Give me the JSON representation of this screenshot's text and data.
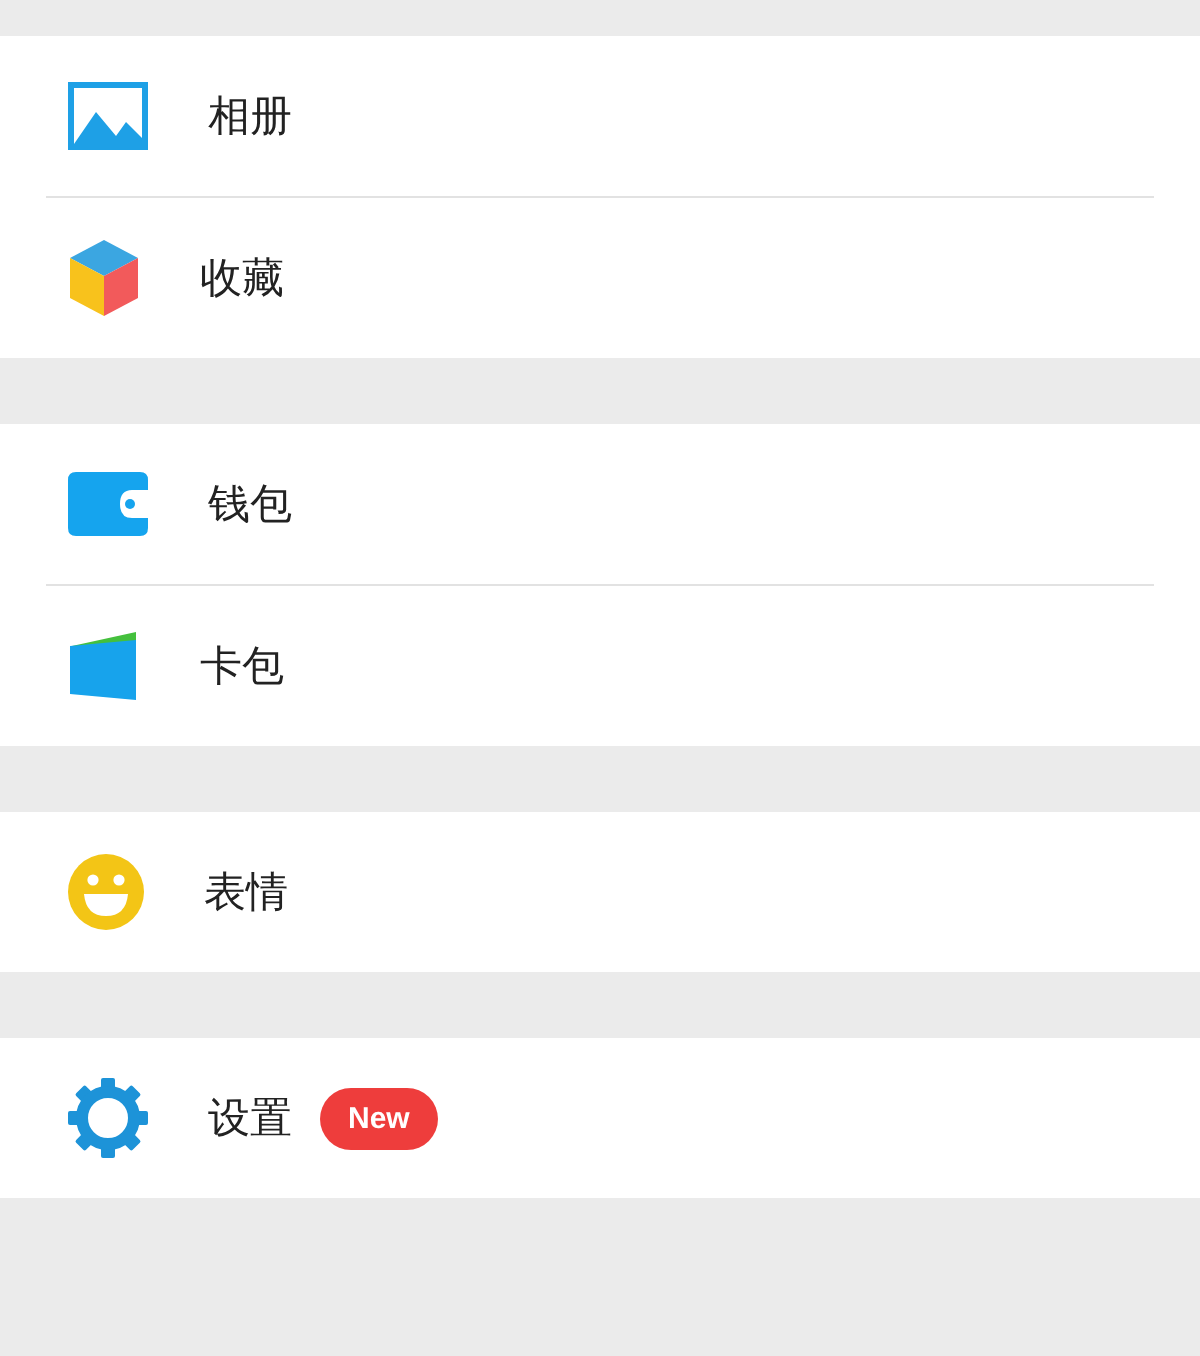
{
  "groups": [
    {
      "items": [
        {
          "label": "相册"
        },
        {
          "label": "收藏"
        }
      ]
    },
    {
      "items": [
        {
          "label": "钱包"
        },
        {
          "label": "卡包"
        }
      ]
    },
    {
      "items": [
        {
          "label": "表情"
        }
      ]
    },
    {
      "items": [
        {
          "label": "设置",
          "badge": "New"
        }
      ]
    }
  ]
}
